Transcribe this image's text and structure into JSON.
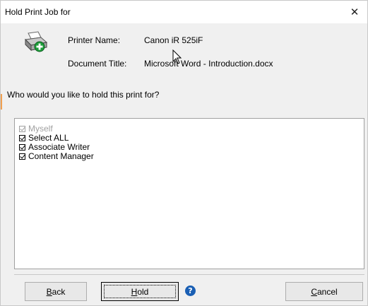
{
  "window": {
    "title": "Hold Print Job for",
    "close_glyph": "✕"
  },
  "info": {
    "printer_label": "Printer Name:",
    "printer_value": "Canon iR 525iF",
    "document_label": "Document Title:",
    "document_value": "Microsoft Word - Introduction.docx"
  },
  "prompt": "Who would you like to hold this print for?",
  "recipients": [
    {
      "label": "Myself",
      "checked": true,
      "disabled": true
    },
    {
      "label": "Select ALL",
      "checked": true,
      "disabled": false
    },
    {
      "label": "Associate Writer",
      "checked": true,
      "disabled": false
    },
    {
      "label": "Content Manager",
      "checked": true,
      "disabled": false
    }
  ],
  "buttons": {
    "back_accel": "B",
    "back_rest": "ack",
    "hold_accel": "H",
    "hold_rest": "old",
    "cancel_accel": "C",
    "cancel_rest": "ancel"
  },
  "icons": {
    "printer": "printer-add-icon",
    "help": "help-icon",
    "close": "close-icon"
  },
  "colors": {
    "help_blue": "#1a5fb4",
    "printer_green": "#1e9e3a"
  }
}
